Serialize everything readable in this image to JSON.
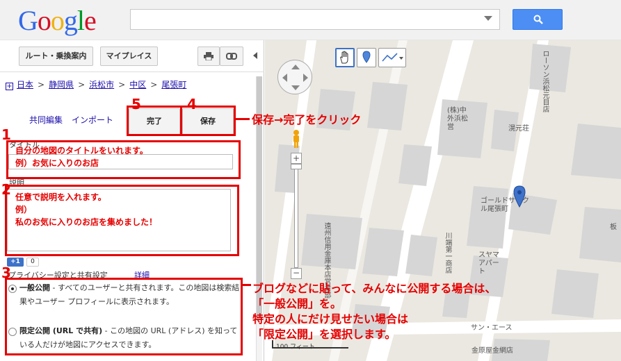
{
  "header": {
    "logo_letters": [
      "G",
      "o",
      "o",
      "g",
      "l",
      "e"
    ],
    "search_placeholder": ""
  },
  "toolbar": {
    "route_label": "ルート・乗換案内",
    "myplaces_label": "マイプレイス"
  },
  "breadcrumb": {
    "expand": "+",
    "items": [
      "日本",
      "静岡県",
      "浜松市",
      "中区",
      "尾張町"
    ],
    "separator": ">"
  },
  "editor": {
    "collab_label": "共同編集",
    "import_label": "インポート",
    "done_label": "完了",
    "save_label": "保存",
    "title_label": "タイトル",
    "desc_label": "説明",
    "plus_one": "+1",
    "plus_one_count": "0",
    "privacy_heading": "プライバシー設定と共有設定",
    "details_link": "詳細",
    "public_option": {
      "name": "一般公開",
      "text": " - すべてのユーザーと共有されます。この地図は検索結果やユーザー プロフィールに表示されます。"
    },
    "limited_option": {
      "name": "限定公開 (URL で共有)",
      "text": " - この地図の URL (アドレス) を知っている人だけが地図にアクセスできます。"
    }
  },
  "map": {
    "labels": {
      "lawson": "ローソン浜松元目店",
      "chugai": "(株)中外浜松営",
      "kosuisou": "滉元荘",
      "gold_circle": "ゴールドサークル尾張町",
      "higashi": "遠州信用金庫本店営業部",
      "kawabata": "川端第一商店",
      "sumaya": "スヤマアパート",
      "sun_ace": "サン・エース",
      "kinbara": "金原屋金網店",
      "itano": "板"
    },
    "scale_label": "100 フィート"
  },
  "annotations": {
    "num_title": "1",
    "num_desc": "2",
    "num_privacy": "3",
    "num_save": "4",
    "num_done": "5",
    "title_text_1": "自分の地図のタイトルをいれます。",
    "title_text_2": "例）お気に入りのお店",
    "desc_text_1": "任意で説明を入れます。",
    "desc_text_2": "例）",
    "desc_text_3": "私のお気に入りのお店を集めました！",
    "save_done_instruction": "保存→完了をクリック",
    "privacy_instruction_1": "ブログなどに貼って、みんなに公開する場合は、",
    "privacy_instruction_2": "「一般公開」を。",
    "privacy_instruction_3": "特定の人にだけ見せたい場合は",
    "privacy_instruction_4": "「限定公開」を選択します。"
  },
  "colors": {
    "annotation_red": "#e50000",
    "search_blue": "#4c8ef4",
    "link_blue": "#1a0dab",
    "map_background": "#ebe8e1"
  }
}
